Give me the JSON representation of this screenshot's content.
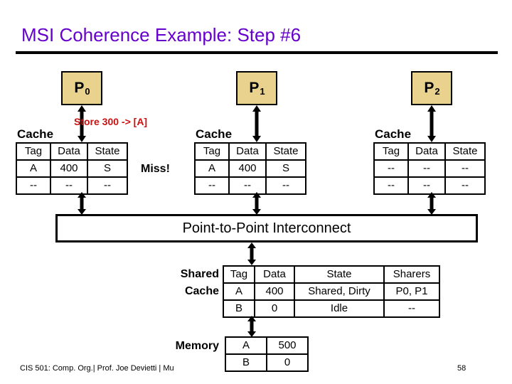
{
  "slide": {
    "title": "MSI Coherence Example: Step #6",
    "title_color": "#6600cc",
    "page_number": "58",
    "footer": "CIS 501: Comp. Org.|  Prof. Joe Devietti  |  Mu"
  },
  "annotations": {
    "store_op": "Store 300 -> [A]",
    "store_color": "#cc1111",
    "miss": "Miss!"
  },
  "interconnect": {
    "label": "Point-to-Point Interconnect"
  },
  "processors": [
    {
      "id": "P0",
      "name": "P",
      "index": "0",
      "cache_label": "Cache",
      "cache": {
        "headers": [
          "Tag",
          "Data",
          "State"
        ],
        "rows": [
          {
            "cells": [
              "A",
              "400",
              "S"
            ],
            "shaded": [
              true,
              false,
              true
            ]
          },
          {
            "cells": [
              "--",
              "--",
              "--"
            ],
            "shaded": [
              false,
              false,
              false
            ]
          }
        ]
      }
    },
    {
      "id": "P1",
      "name": "P",
      "index": "1",
      "cache_label": "Cache",
      "cache": {
        "headers": [
          "Tag",
          "Data",
          "State"
        ],
        "rows": [
          {
            "cells": [
              "A",
              "400",
              "S"
            ],
            "shaded": [
              false,
              false,
              false
            ]
          },
          {
            "cells": [
              "--",
              "--",
              "--"
            ],
            "shaded": [
              false,
              false,
              false
            ]
          }
        ]
      }
    },
    {
      "id": "P2",
      "name": "P",
      "index": "2",
      "cache_label": "Cache",
      "cache": {
        "headers": [
          "Tag",
          "Data",
          "State"
        ],
        "rows": [
          {
            "cells": [
              "--",
              "--",
              "--"
            ],
            "shaded": [
              false,
              false,
              false
            ]
          },
          {
            "cells": [
              "--",
              "--",
              "--"
            ],
            "shaded": [
              false,
              false,
              false
            ]
          }
        ]
      }
    }
  ],
  "shared_cache": {
    "label_line1": "Shared",
    "label_line2": "Cache",
    "headers": [
      "Tag",
      "Data",
      "State",
      "Sharers"
    ],
    "rows": [
      [
        "A",
        "400",
        "Shared, Dirty",
        "P0, P1"
      ],
      [
        "B",
        "0",
        "Idle",
        "--"
      ]
    ]
  },
  "memory": {
    "label": "Memory",
    "rows": [
      [
        "A",
        "500"
      ],
      [
        "B",
        "0"
      ]
    ]
  },
  "colors": {
    "processor_fill": "#e8d28d",
    "shaded_cell": "#d6d6d6",
    "line": "#000000"
  }
}
